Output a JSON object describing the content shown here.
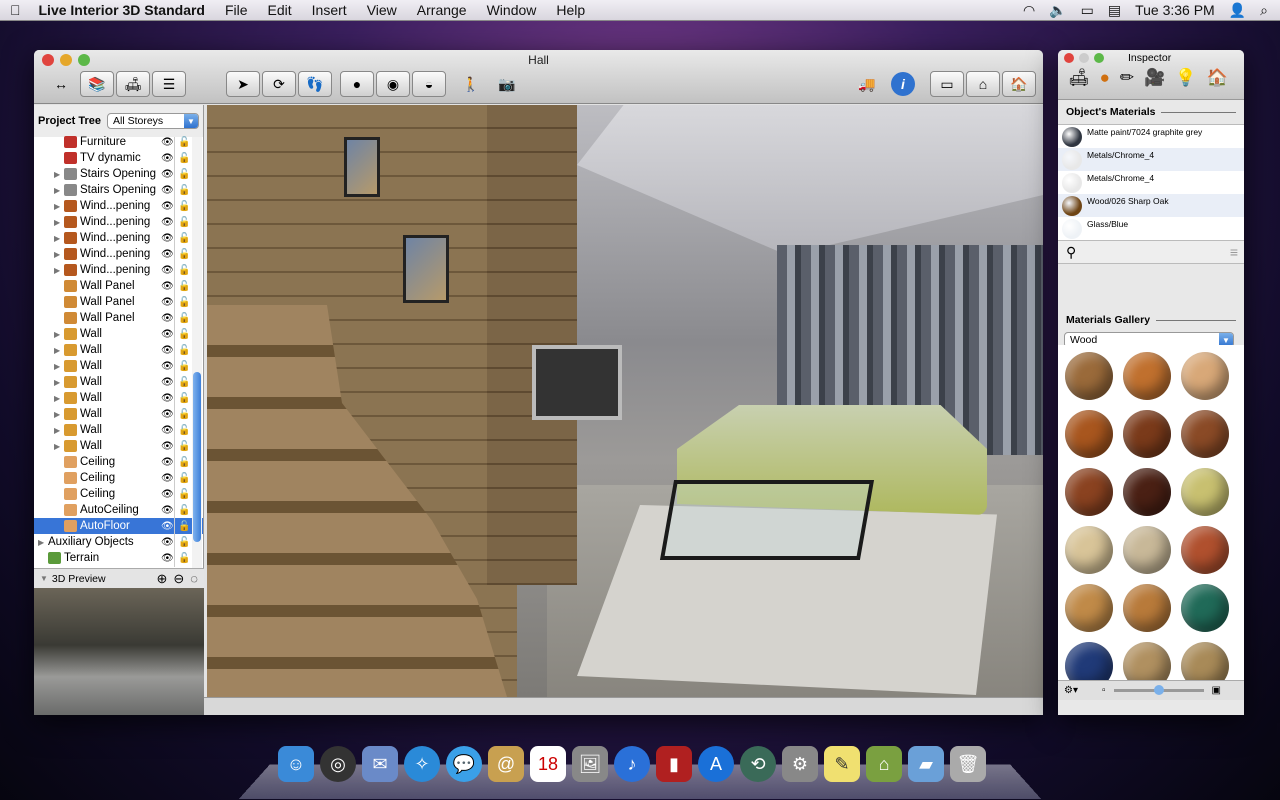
{
  "menubar": {
    "app": "Live Interior 3D Standard",
    "items": [
      "File",
      "Edit",
      "Insert",
      "View",
      "Arrange",
      "Window",
      "Help"
    ],
    "clock": "Tue 3:36 PM"
  },
  "window": {
    "title": "Hall"
  },
  "tree": {
    "label": "Project Tree",
    "storey": "All Storeys",
    "rows": [
      {
        "label": "Furniture",
        "icon": "furniture",
        "color": "#c0302a",
        "exp": false
      },
      {
        "label": "TV dynamic",
        "icon": "furniture",
        "color": "#c0302a",
        "exp": false
      },
      {
        "label": "Stairs Opening",
        "icon": "stairs",
        "color": "#888888",
        "exp": true
      },
      {
        "label": "Stairs Opening",
        "icon": "stairs",
        "color": "#888888",
        "exp": true
      },
      {
        "label": "Wind...pening",
        "icon": "window",
        "color": "#b5581e",
        "exp": true
      },
      {
        "label": "Wind...pening",
        "icon": "window",
        "color": "#b5581e",
        "exp": true
      },
      {
        "label": "Wind...pening",
        "icon": "window",
        "color": "#b5581e",
        "exp": true
      },
      {
        "label": "Wind...pening",
        "icon": "window",
        "color": "#b5581e",
        "exp": true
      },
      {
        "label": "Wind...pening",
        "icon": "window",
        "color": "#b5581e",
        "exp": true
      },
      {
        "label": "Wall Panel",
        "icon": "wall-panel",
        "color": "#d08a35",
        "exp": false
      },
      {
        "label": "Wall Panel",
        "icon": "wall-panel",
        "color": "#d08a35",
        "exp": false
      },
      {
        "label": "Wall Panel",
        "icon": "wall-panel",
        "color": "#d08a35",
        "exp": false
      },
      {
        "label": "Wall",
        "icon": "wall",
        "color": "#d89a30",
        "exp": true
      },
      {
        "label": "Wall",
        "icon": "wall",
        "color": "#d89a30",
        "exp": true
      },
      {
        "label": "Wall",
        "icon": "wall",
        "color": "#d89a30",
        "exp": true
      },
      {
        "label": "Wall",
        "icon": "wall",
        "color": "#d89a30",
        "exp": true
      },
      {
        "label": "Wall",
        "icon": "wall",
        "color": "#d89a30",
        "exp": true
      },
      {
        "label": "Wall",
        "icon": "wall",
        "color": "#d89a30",
        "exp": true
      },
      {
        "label": "Wall",
        "icon": "wall",
        "color": "#d89a30",
        "exp": true
      },
      {
        "label": "Wall",
        "icon": "wall",
        "color": "#d89a30",
        "exp": true
      },
      {
        "label": "Ceiling",
        "icon": "ceiling",
        "color": "#e0a060",
        "exp": false
      },
      {
        "label": "Ceiling",
        "icon": "ceiling",
        "color": "#e0a060",
        "exp": false
      },
      {
        "label": "Ceiling",
        "icon": "ceiling",
        "color": "#e0a060",
        "exp": false
      },
      {
        "label": "AutoCeiling",
        "icon": "ceiling",
        "color": "#e0a060",
        "exp": false
      },
      {
        "label": "AutoFloor",
        "icon": "floor",
        "color": "#e0a060",
        "exp": false,
        "selected": true
      },
      {
        "label": "Auxiliary Objects",
        "icon": "none",
        "color": "",
        "exp": true,
        "top": true
      },
      {
        "label": "Terrain",
        "icon": "terrain",
        "color": "#5a9a3a",
        "exp": false,
        "top": true
      }
    ],
    "preview_label": "3D Preview"
  },
  "inspector": {
    "title": "Inspector",
    "objects_heading": "Object's Materials",
    "materials": [
      {
        "name": "Matte paint/7024 graphite grey",
        "color": "#2f3540"
      },
      {
        "name": "Metals/Chrome_4",
        "color": "#e8e8e8"
      },
      {
        "name": "Metals/Chrome_4",
        "color": "#e8e8e8"
      },
      {
        "name": "Wood/026 Sharp Oak",
        "color": "#6e4414"
      },
      {
        "name": "Glass/Blue",
        "color": "#eef2f6"
      }
    ],
    "gallery_heading": "Materials Gallery",
    "gallery_category": "Wood",
    "swatches": [
      "#9a6a3a",
      "#c0702e",
      "#d8a878",
      "#a8561e",
      "#7a3a1a",
      "#8a4a26",
      "#8a4220",
      "#4a2014",
      "#c8c070",
      "#d8c498",
      "#c8b898",
      "#b0502e",
      "#c08a48",
      "#b87a3a",
      "#206a58",
      "#203a78",
      "#b09060",
      "#a88a58"
    ]
  },
  "colors": {
    "selection": "#3875d7",
    "accent": "#2f72cf"
  }
}
